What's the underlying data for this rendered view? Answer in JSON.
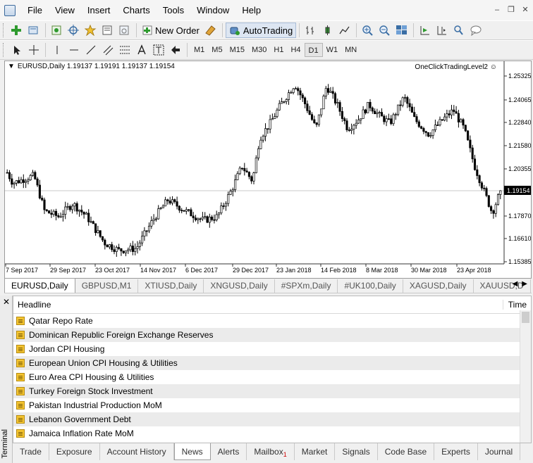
{
  "menubar": {
    "items": [
      "File",
      "View",
      "Insert",
      "Charts",
      "Tools",
      "Window",
      "Help"
    ]
  },
  "toolbar": {
    "new_order": "New Order",
    "auto_trading": "AutoTrading"
  },
  "timeframes": [
    "M1",
    "M5",
    "M15",
    "M30",
    "H1",
    "H4",
    "D1",
    "W1",
    "MN"
  ],
  "chart": {
    "symbol_line": "EURUSD,Daily  1.19137 1.19191 1.19137 1.19154",
    "plugin": "OneClickTradingLevel2",
    "price_label": "1.19154",
    "y_ticks": [
      "1.25325",
      "1.24065",
      "1.22840",
      "1.21580",
      "1.20355",
      "1.17870",
      "1.16610",
      "1.15385"
    ],
    "x_ticks": [
      "7 Sep 2017",
      "29 Sep 2017",
      "23 Oct 2017",
      "14 Nov 2017",
      "6 Dec 2017",
      "29 Dec 2017",
      "23 Jan 2018",
      "14 Feb 2018",
      "8 Mar 2018",
      "30 Mar 2018",
      "23 Apr 2018"
    ]
  },
  "chart_tabs": [
    "EURUSD,Daily",
    "GBPUSD,M1",
    "XTIUSD,Daily",
    "XNGUSD,Daily",
    "#SPXm,Daily",
    "#UK100,Daily",
    "XAGUSD,Daily",
    "XAUUSD,D"
  ],
  "news": {
    "header_headline": "Headline",
    "header_time": "Time",
    "rows": [
      "Qatar Repo Rate",
      "Dominican Republic Foreign Exchange Reserves",
      "Jordan CPI Housing",
      "European Union CPI Housing & Utilities",
      "Euro Area CPI Housing & Utilities",
      "Turkey Foreign Stock Investment",
      "Pakistan Industrial Production MoM",
      "Lebanon Government Debt",
      "Jamaica Inflation Rate MoM"
    ]
  },
  "terminal": {
    "label": "Terminal"
  },
  "bottom_tabs": [
    {
      "label": "Trade",
      "badge": ""
    },
    {
      "label": "Exposure",
      "badge": ""
    },
    {
      "label": "Account History",
      "badge": ""
    },
    {
      "label": "News",
      "badge": ""
    },
    {
      "label": "Alerts",
      "badge": ""
    },
    {
      "label": "Mailbox",
      "badge": "1"
    },
    {
      "label": "Market",
      "badge": ""
    },
    {
      "label": "Signals",
      "badge": ""
    },
    {
      "label": "Code Base",
      "badge": ""
    },
    {
      "label": "Experts",
      "badge": ""
    },
    {
      "label": "Journal",
      "badge": ""
    }
  ],
  "colors": {
    "bull": "#ffffff",
    "bear": "#000000",
    "accent": "#3a6ea5"
  }
}
